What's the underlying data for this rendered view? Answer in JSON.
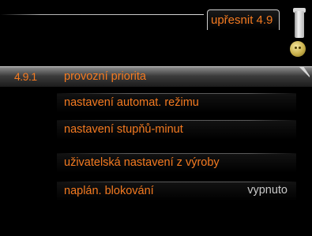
{
  "header": {
    "title": "upřesnit 4.9"
  },
  "menu": {
    "selected_index": 0,
    "items": [
      {
        "number": "4.9.1",
        "label": "provozní priorita",
        "value": ""
      },
      {
        "number": "",
        "label": "nastavení automat. režimu",
        "value": ""
      },
      {
        "number": "",
        "label": "nastavení stupňů-minut",
        "value": ""
      },
      {
        "number": "",
        "label": "uživatelská nastavení z výroby",
        "value": ""
      },
      {
        "number": "",
        "label": "naplán. blokování",
        "value": "vypnuto"
      }
    ]
  },
  "colors": {
    "accent": "#f47a20",
    "value_text": "#c8c8c8",
    "background": "#000000"
  },
  "icons": {
    "status": "smiley-status-icon",
    "scroll": "scrollbar-icon"
  }
}
